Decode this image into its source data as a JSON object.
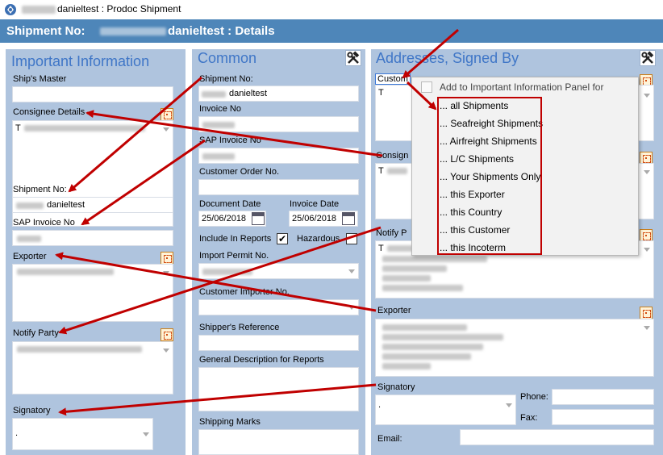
{
  "window": {
    "title_suffix": "danieltest : Prodoc Shipment",
    "app_icon": "prodoc-app-icon"
  },
  "header": {
    "prefix": "Shipment No:",
    "suffix": "danieltest : Details",
    "bg_color": "#4e86b9"
  },
  "important_panel": {
    "title": "Important Information",
    "ships_master_label": "Ship's Master",
    "consignee_label": "Consignee Details",
    "consignee_value_first_char": "T",
    "shipment_no_label": "Shipment No:",
    "shipment_no_value": "danieltest",
    "sap_invoice_label": "SAP Invoice No",
    "exporter_label": "Exporter",
    "notify_party_label": "Notify Party",
    "signatory_label": "Signatory",
    "signatory_value": "."
  },
  "common_panel": {
    "title": "Common",
    "shipment_no_label": "Shipment No:",
    "shipment_no_value": "danieltest",
    "invoice_no_label": "Invoice No",
    "sap_invoice_label": "SAP Invoice No",
    "customer_order_label": "Customer Order No.",
    "document_date_label": "Document Date",
    "document_date_value": "25/06/2018",
    "invoice_date_label": "Invoice Date",
    "invoice_date_value": "25/06/2018",
    "include_in_reports_label": "Include In Reports",
    "include_in_reports_checked": "✔",
    "hazardous_label": "Hazardous",
    "import_permit_label": "Import Permit No.",
    "customer_importer_label": "Customer Importer No.",
    "shippers_reference_label": "Shipper's Reference",
    "general_description_label": "General Description for Reports",
    "shipping_marks_label": "Shipping Marks"
  },
  "addresses_panel": {
    "title": "Addresses, Signed By",
    "customer_label": "Custom",
    "customer_value_first_char": "T",
    "consignee_label": "Consign",
    "consignee_value_first_char": "T",
    "notify_label": "Notify P",
    "notify_value_first_char": "T",
    "exporter_label": "Exporter",
    "signatory_label": "Signatory",
    "signatory_value": ".",
    "phone_label": "Phone:",
    "fax_label": "Fax:",
    "email_label": "Email:"
  },
  "context_menu": {
    "header": "Add to Important Information Panel for",
    "items": [
      "... all Shipments",
      "... Seafreight Shipments",
      "... Airfreight Shipments",
      "... L/C Shipments",
      "... Your Shipments Only",
      "... this Exporter",
      "... this Country",
      "... this Customer",
      "... this Incoterm"
    ]
  },
  "colors": {
    "panel_bg": "#afc4de",
    "panel_title": "#3f76c7",
    "annotation_red": "#c00000"
  }
}
